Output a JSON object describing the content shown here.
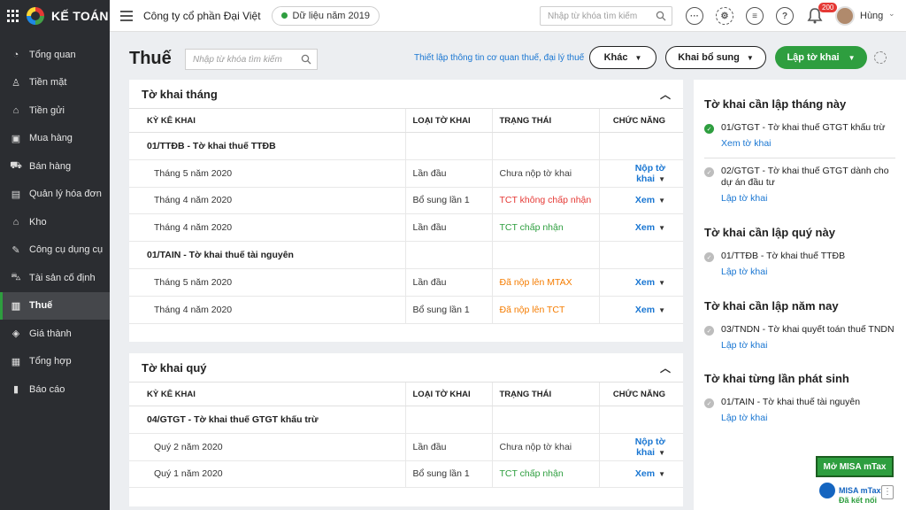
{
  "sidebar": {
    "brand": "KẾ TOÁN",
    "items": [
      {
        "label": "Tổng quan",
        "icon": "gauge-icon"
      },
      {
        "label": "Tiền mặt",
        "icon": "cash-bag-icon"
      },
      {
        "label": "Tiền gửi",
        "icon": "bank-icon"
      },
      {
        "label": "Mua hàng",
        "icon": "shopping-bag-icon"
      },
      {
        "label": "Bán hàng",
        "icon": "cart-icon"
      },
      {
        "label": "Quản lý hóa đơn",
        "icon": "invoice-icon"
      },
      {
        "label": "Kho",
        "icon": "warehouse-icon"
      },
      {
        "label": "Công cụ dụng cụ",
        "icon": "tools-icon"
      },
      {
        "label": "Tài sản cố định",
        "icon": "car-icon"
      },
      {
        "label": "Thuế",
        "icon": "tax-building-icon"
      },
      {
        "label": "Giá thành",
        "icon": "price-tag-icon"
      },
      {
        "label": "Tổng hợp",
        "icon": "book-icon"
      },
      {
        "label": "Báo cáo",
        "icon": "bar-chart-icon"
      }
    ],
    "active_index": 9
  },
  "topbar": {
    "company": "Công ty cổ phần Đại Việt",
    "data_year": "Dữ liệu năm 2019",
    "search_placeholder": "Nhập từ khóa tìm kiếm",
    "notification_count": "200",
    "user": "Hùng"
  },
  "header": {
    "title": "Thuế",
    "search_placeholder": "Nhập từ khóa tìm kiếm",
    "setup_link": "Thiết lập thông tin cơ quan thuế, đại lý thuế",
    "btn_other": "Khác",
    "btn_supplement": "Khai bổ sung",
    "btn_create": "Lập tờ khai"
  },
  "columns": [
    "KỲ KÊ KHAI",
    "LOẠI TỜ KHAI",
    "TRẠNG THÁI",
    "CHỨC NĂNG"
  ],
  "monthly": {
    "title": "Tờ khai tháng",
    "groups": [
      {
        "name": "01/TTĐB - Tờ khai thuế TTĐB",
        "rows": [
          {
            "period": "Tháng 5 năm 2020",
            "type": "Lần đầu",
            "status": "Chưa nộp tờ khai",
            "status_class": "st-gray",
            "action": "Nộp tờ khai"
          },
          {
            "period": "Tháng 4 năm 2020",
            "type": "Bổ sung lần 1",
            "status": "TCT không chấp nhận",
            "status_class": "st-red",
            "action": "Xem"
          },
          {
            "period": "Tháng 4 năm 2020",
            "type": "Lần đầu",
            "status": "TCT chấp nhận",
            "status_class": "st-green",
            "action": "Xem"
          }
        ]
      },
      {
        "name": "01/TAIN - Tờ khai thuế tài nguyên",
        "rows": [
          {
            "period": "Tháng 5 năm 2020",
            "type": "Lần đầu",
            "status": "Đã nộp lên MTAX",
            "status_class": "st-orange",
            "action": "Xem"
          },
          {
            "period": "Tháng 4 năm 2020",
            "type": "Bổ sung lần 1",
            "status": "Đã nộp lên TCT",
            "status_class": "st-orange",
            "action": "Xem"
          }
        ]
      }
    ]
  },
  "quarterly": {
    "title": "Tờ khai quý",
    "groups": [
      {
        "name": "04/GTGT - Tờ khai thuế GTGT khấu trừ",
        "rows": [
          {
            "period": "Quý 2 năm 2020",
            "type": "Lần đầu",
            "status": "Chưa nộp tờ khai",
            "status_class": "st-gray",
            "action": "Nộp tờ khai"
          },
          {
            "period": "Quý 1 năm 2020",
            "type": "Bổ sung lần 1",
            "status": "TCT chấp nhận",
            "status_class": "st-green",
            "action": "Xem"
          }
        ]
      }
    ]
  },
  "right": {
    "month_title": "Tờ khai cần lập tháng này",
    "month_item1": "01/GTGT - Tờ khai thuế GTGT khấu trừ",
    "month_item1_link": "Xem tờ khai",
    "month_item2": "02/GTGT - Tờ khai thuế GTGT dành cho dự án đầu tư",
    "month_item2_link": "Lập tờ khai",
    "quarter_title": "Tờ khai cần lập quý này",
    "quarter_item1": "01/TTĐB - Tờ khai thuế TTĐB",
    "quarter_item1_link": "Lập tờ khai",
    "year_title": "Tờ khai cần lập năm nay",
    "year_item1": "03/TNDN - Tờ khai quyết toán thuế TNDN",
    "year_item1_link": "Lập tờ khai",
    "each_title": "Tờ khai từng lần phát sinh",
    "each_item1": "01/TAIN - Tờ khai thuế tài nguyên",
    "each_item1_link": "Lập tờ khai"
  },
  "mtax": {
    "button": "Mở MISA mTax",
    "name": "MISA mTax",
    "status": "Đã kết nối"
  },
  "colors": {
    "sidebar_bg": "#2b2d31",
    "accent_green": "#2e9e3f",
    "link_blue": "#1976d2",
    "status_red": "#e53935",
    "status_orange": "#f57c00"
  }
}
